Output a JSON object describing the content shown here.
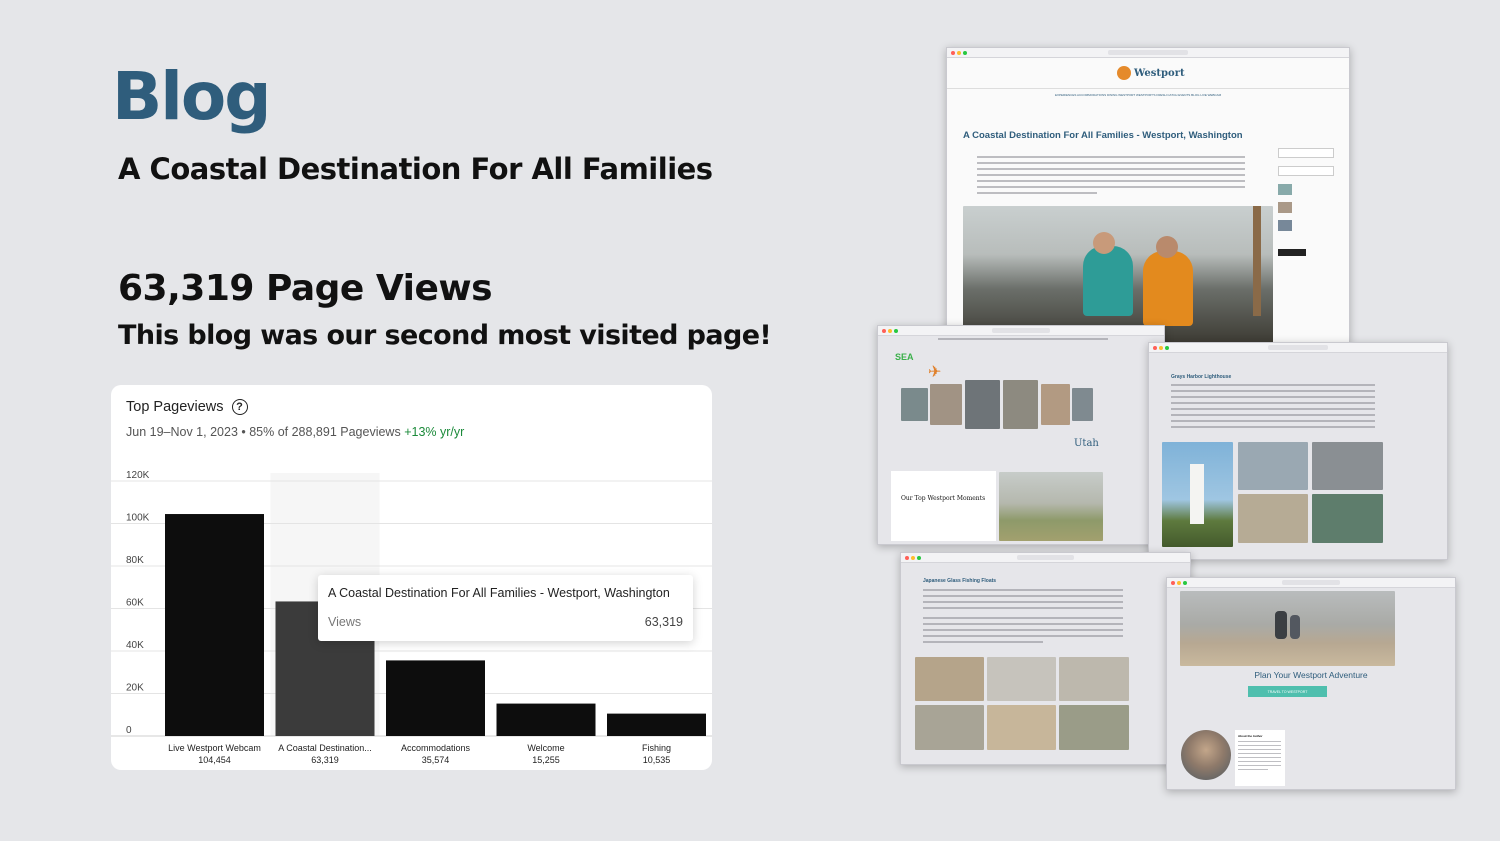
{
  "header": {
    "title": "Blog",
    "subtitle": "A Coastal Destination For All Families",
    "page_views": "63,319 Page Views",
    "note": "This blog was our second most visited page!"
  },
  "card": {
    "title": "Top Pageviews",
    "date_range": "Jun 19–Nov 1, 2023",
    "share": " • 85% of 288,891 Pageviews ",
    "growth": "+13% yr/yr"
  },
  "tooltip": {
    "title": "A Coastal Destination For All Families - Westport, Washington",
    "label": "Views",
    "value": "63,319"
  },
  "chart_data": {
    "type": "bar",
    "categories": [
      "Live Westport Webcam",
      "A Coastal Destination...",
      "Accommodations",
      "Welcome",
      "Fishing"
    ],
    "value_labels": [
      "104,454",
      "63,319",
      "35,574",
      "15,255",
      "10,535"
    ],
    "values": [
      104454,
      63319,
      35574,
      15255,
      10535
    ],
    "highlight_index": 1,
    "ylim": [
      0,
      120000
    ],
    "yticks": [
      0,
      20000,
      40000,
      60000,
      80000,
      100000,
      120000
    ],
    "ytick_labels": [
      "0",
      "20K",
      "40K",
      "60K",
      "80K",
      "100K",
      "120K"
    ],
    "grid": true,
    "colors": {
      "bar": "#0d0d0d",
      "highlight": "#3b3b3b",
      "grid": "#e4e4e4"
    }
  },
  "screenshots": {
    "main": {
      "logo": "Westport",
      "nav": "EXPERIENCES  ACCOMMODATIONS  DINING  WESTPORT  WESTPORT'S FRESH CATCH  EVENTS  BLOG  LIVE WEBCAM",
      "post_title": "A Coastal Destination For All Families - Westport, Washington"
    },
    "travel": {
      "sea_label": "SEA",
      "utah_label": "Utah",
      "moments_title": "Our Top Westport Moments"
    },
    "lighthouse": {
      "heading": "Grays Harbor Lighthouse"
    },
    "floats": {
      "heading": "Japanese Glass Fishing Floats"
    },
    "adventure": {
      "heading": "Plan Your Westport Adventure",
      "button": "TRAVEL TO WESTPORT",
      "author": "About the Author"
    }
  }
}
